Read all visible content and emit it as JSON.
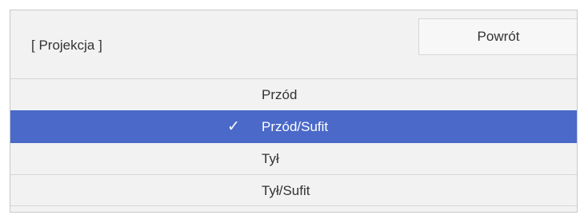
{
  "header": {
    "title": "[ Projekcja ]",
    "back_label": "Powrót"
  },
  "options": [
    {
      "label": "Przód",
      "selected": false
    },
    {
      "label": "Przód/Sufit",
      "selected": true,
      "check_glyph": "✓"
    },
    {
      "label": "Tył",
      "selected": false
    },
    {
      "label": "Tył/Sufit",
      "selected": false
    }
  ],
  "colors": {
    "selection": "#4a69c8",
    "panel_bg": "#f2f2f2"
  },
  "icons": {
    "selected_marker": "checkmark-icon"
  }
}
